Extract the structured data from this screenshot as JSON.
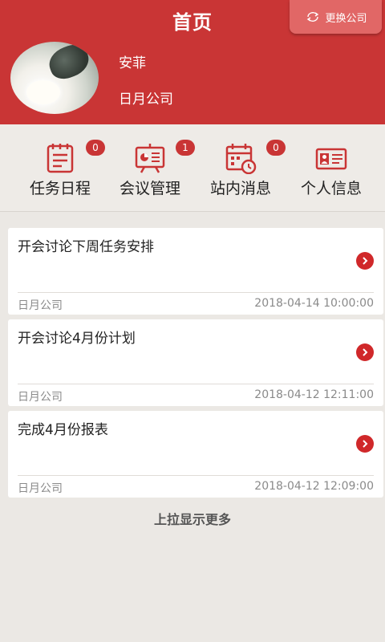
{
  "header": {
    "title": "首页",
    "switch_company_label": "更换公司",
    "user_name": "安菲",
    "company": "日月公司",
    "background_color": "#c93535"
  },
  "nav": [
    {
      "label": "任务日程",
      "badge": "0",
      "icon": "task-calendar-icon"
    },
    {
      "label": "会议管理",
      "badge": "1",
      "icon": "presentation-board-icon"
    },
    {
      "label": "站内消息",
      "badge": "0",
      "icon": "calendar-clock-icon"
    },
    {
      "label": "个人信息",
      "badge": null,
      "icon": "id-card-icon"
    }
  ],
  "tasks": [
    {
      "title": "开会讨论下周任务安排",
      "company": "日月公司",
      "datetime": "2018-04-14 10:00:00"
    },
    {
      "title": "开会讨论4月份计划",
      "company": "日月公司",
      "datetime": "2018-04-12 12:11:00"
    },
    {
      "title": "完成4月份报表",
      "company": "日月公司",
      "datetime": "2018-04-12 12:09:00"
    }
  ],
  "load_more_label": "上拉显示更多",
  "accent_color": "#c93535"
}
